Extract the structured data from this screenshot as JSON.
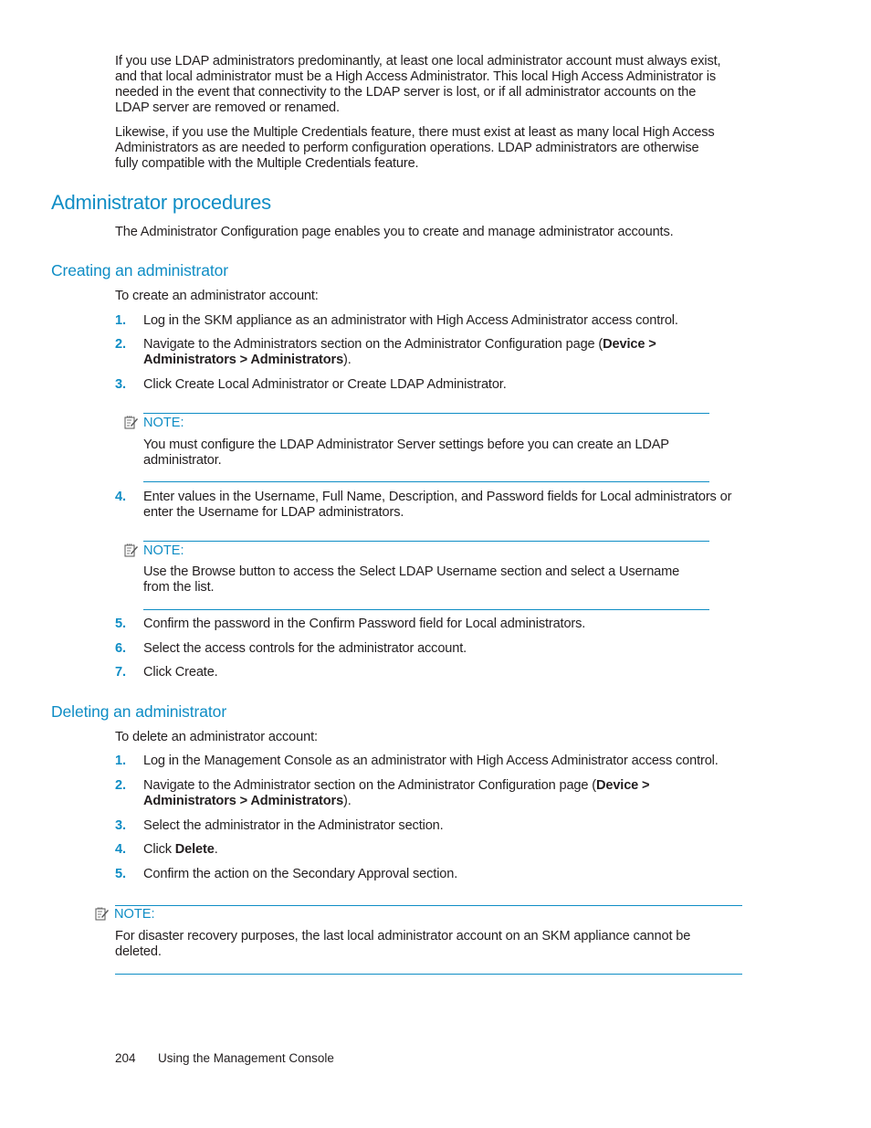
{
  "intro": {
    "paragraph1": [
      "If you use LDAP administrators predominantly, at least one local administrator account must always exist,",
      "and that local administrator must be a High Access Administrator.  This local High Access Administrator is",
      "needed in the event that connectivity to the LDAP server is lost, or if all administrator accounts on the",
      "LDAP server are removed or renamed."
    ],
    "paragraph2": [
      "Likewise, if you use the Multiple Credentials feature, there must exist at least as many local High Access",
      "Administrators as are needed to perform configuration operations.  LDAP administrators are otherwise",
      "fully compatible with the Multiple Credentials feature."
    ]
  },
  "section": {
    "title": "Administrator procedures",
    "description": "The Administrator Configuration page enables you to create and manage administrator accounts."
  },
  "creating": {
    "title": "Creating an administrator",
    "lead": "To create an administrator account:",
    "steps": [
      {
        "num": "1.",
        "text": "Log in the SKM appliance as an administrator with High Access Administrator access control."
      },
      {
        "num": "2.",
        "text_before": "Navigate to the Administrators section on the Administrator Configuration page (",
        "bold1": "Device >",
        "bold2": "Administrators > Administrators",
        "text_after": ")."
      },
      {
        "num": "3.",
        "text": "Click Create Local Administrator or Create LDAP Administrator."
      },
      {
        "num": "4.",
        "line1": "Enter values in the Username, Full Name, Description, and Password fields for Local administrators or",
        "line2": "enter the Username for LDAP administrators."
      },
      {
        "num": "5.",
        "text": "Confirm the password in the Confirm Password field for Local administrators."
      },
      {
        "num": "6.",
        "text": "Select the access controls for the administrator account."
      },
      {
        "num": "7.",
        "text": "Click Create."
      }
    ],
    "notes": [
      {
        "label": "NOTE:",
        "line1": "You must configure the LDAP Administrator Server settings before you can create an LDAP",
        "line2": "administrator."
      },
      {
        "label": "NOTE:",
        "line1": "Use the Browse button to access the Select LDAP Username section and select a Username",
        "line2": "from the list."
      }
    ]
  },
  "deleting": {
    "title": "Deleting an administrator",
    "lead": "To delete an administrator account:",
    "steps": [
      {
        "num": "1.",
        "text": "Log in the Management Console as an administrator with High Access Administrator access control."
      },
      {
        "num": "2.",
        "text_before": "Navigate to the Administrator section on the Administrator Configuration page (",
        "bold1": "Device >",
        "bold2": "Administrators > Administrators",
        "text_after": ")."
      },
      {
        "num": "3.",
        "text": "Select the administrator in the Administrator section."
      },
      {
        "num": "4.",
        "text_before": "Click ",
        "bold": "Delete",
        "text_after": "."
      },
      {
        "num": "5.",
        "text": "Confirm the action on the Secondary Approval section."
      }
    ],
    "note": {
      "label": "NOTE:",
      "line1": "For disaster recovery purposes, the last local administrator account on an SKM appliance cannot be",
      "line2": "deleted."
    }
  },
  "footer": {
    "page_number": "204",
    "chapter": "Using the Management Console"
  },
  "colors": {
    "accent": "#0f8dc5",
    "text": "#231f20"
  }
}
